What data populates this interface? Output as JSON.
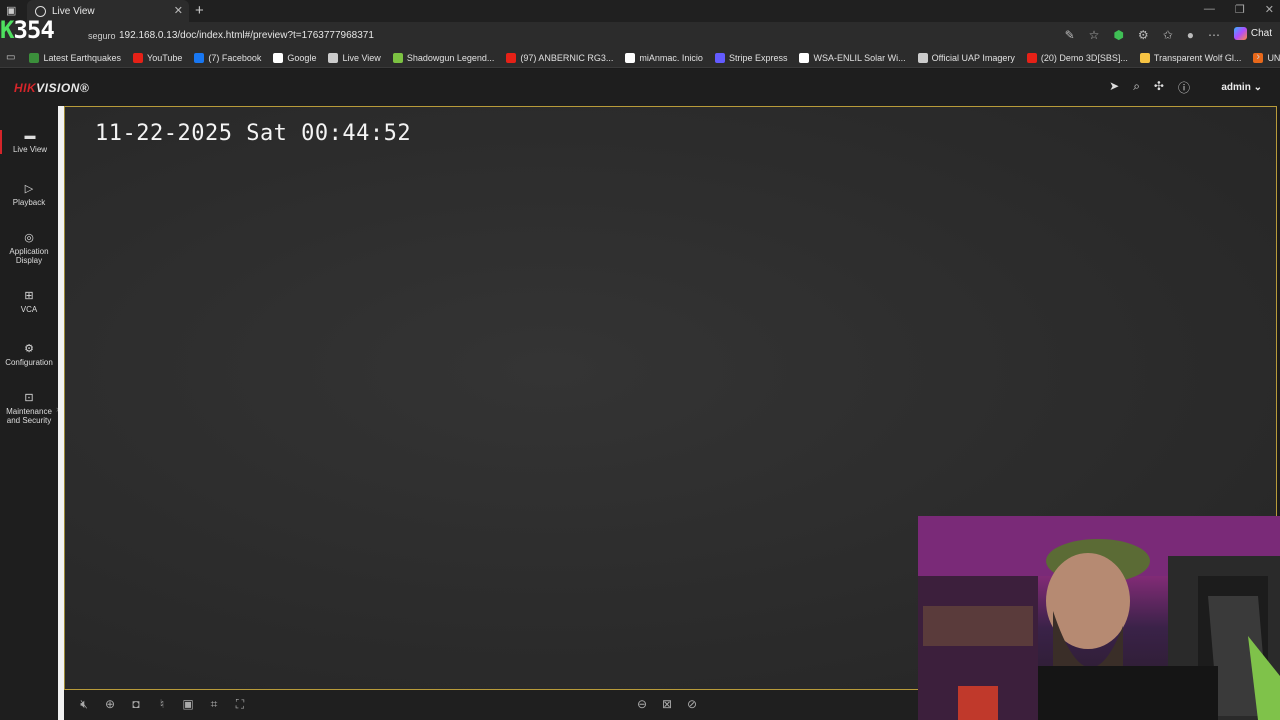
{
  "browser": {
    "tab_title": "Live View",
    "insecure_label": "seguro",
    "url": "192.168.0.13/doc/index.html#/preview?t=1763777968371",
    "chat_label": "Chat",
    "stream_counter_prefix": "K",
    "stream_counter": "354",
    "bookmarks": [
      {
        "label": "Latest Earthquakes",
        "color": "#3b8f3b"
      },
      {
        "label": "YouTube",
        "color": "#e62117"
      },
      {
        "label": "(7) Facebook",
        "color": "#1877f2"
      },
      {
        "label": "Google",
        "color": "#ffffff"
      },
      {
        "label": "Live View",
        "color": "#cccccc"
      },
      {
        "label": "Shadowgun Legend...",
        "color": "#7cc242"
      },
      {
        "label": "(97) ANBERNIC RG3...",
        "color": "#e62117"
      },
      {
        "label": "miAnmac. Inicio",
        "color": "#ffffff"
      },
      {
        "label": "Stripe Express",
        "color": "#635bff"
      },
      {
        "label": "WSA-ENLIL Solar Wi...",
        "color": "#ffffff"
      },
      {
        "label": "Official UAP Imagery",
        "color": "#cccccc"
      },
      {
        "label": "(20) Demo 3D[SBS]...",
        "color": "#e62117"
      },
      {
        "label": "Transparent Wolf Gl...",
        "color": "#f6c343"
      },
      {
        "label": "UNIVERSO RETRO...",
        "color": "#e8681a"
      }
    ]
  },
  "app": {
    "logo_hik": "HIK",
    "logo_vision": "VISION",
    "logo_reg": "®",
    "user": "admin",
    "nav": [
      {
        "label": "Live View"
      },
      {
        "label": "Playback"
      },
      {
        "label": "Application Display"
      },
      {
        "label": "VCA"
      },
      {
        "label": "Configuration"
      },
      {
        "label": "Maintenance and Security"
      }
    ],
    "osd_time": "11-22-2025 Sat 00:44:52"
  }
}
